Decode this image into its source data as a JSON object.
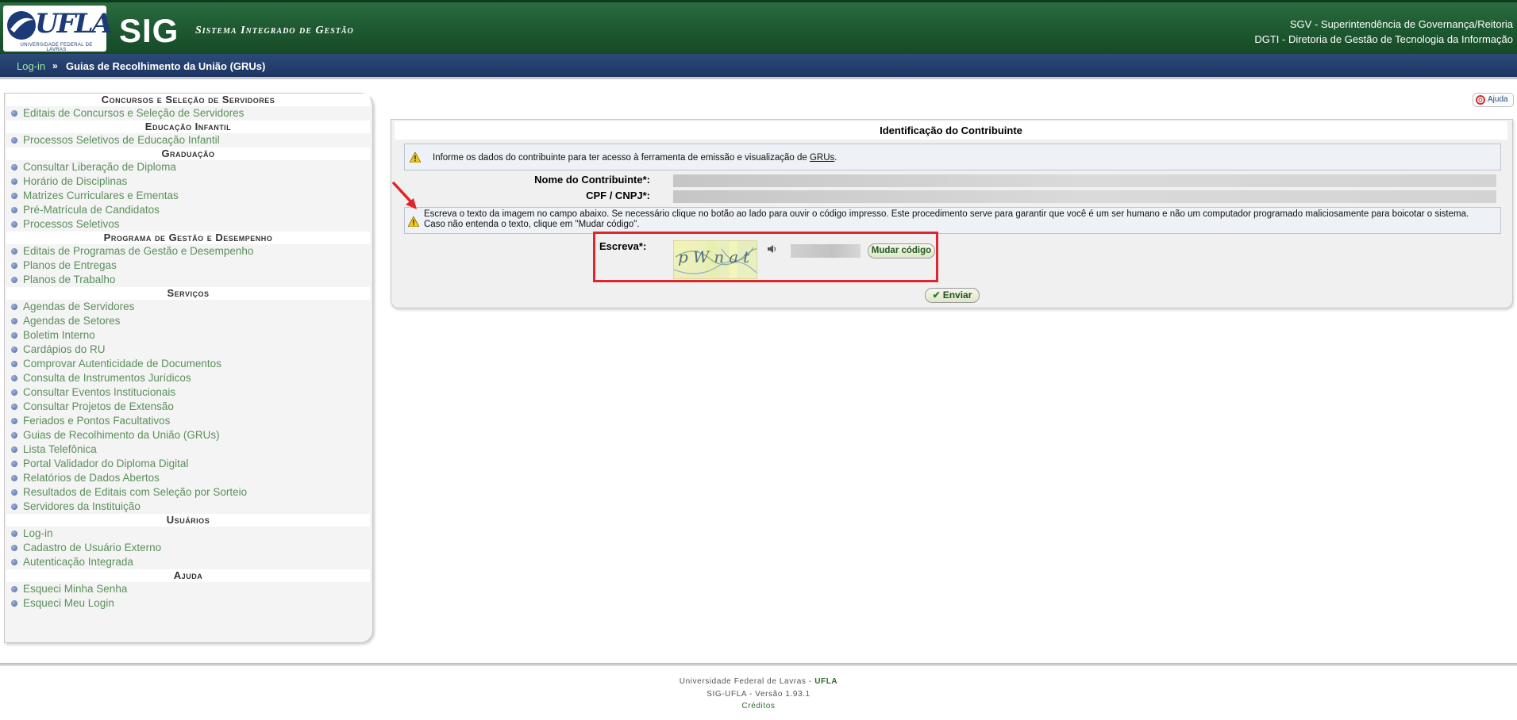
{
  "header": {
    "logo_text": "UFLA",
    "logo_subtitle": "UNIVERSIDADE FEDERAL DE LAVRAS",
    "app_title": "SIG",
    "app_subtitle": "Sistema Integrado de Gestão",
    "right_line_1": "SGV - Superintendência de Governança/Reitoria",
    "right_line_2": "DGTI - Diretoria de Gestão de Tecnologia da Informação"
  },
  "breadcrumb": {
    "link": "Log-in",
    "separator": "»",
    "current": "Guias de Recolhimento da União (GRUs)"
  },
  "sidebar": {
    "sections": [
      {
        "title": "Concursos e Seleção de Servidores",
        "items": [
          "Editais de Concursos e Seleção de Servidores"
        ]
      },
      {
        "title": "Educação Infantil",
        "items": [
          "Processos Seletivos de Educação Infantil"
        ]
      },
      {
        "title": "Graduação",
        "items": [
          "Consultar Liberação de Diploma",
          "Horário de Disciplinas",
          "Matrizes Curriculares e Ementas",
          "Pré-Matrícula de Candidatos",
          "Processos Seletivos"
        ]
      },
      {
        "title": "Programa de Gestão e Desempenho",
        "items": [
          "Editais de Programas de Gestão e Desempenho",
          "Planos de Entregas",
          "Planos de Trabalho"
        ]
      },
      {
        "title": "Serviços",
        "items": [
          "Agendas de Servidores",
          "Agendas de Setores",
          "Boletim Interno",
          "Cardápios do RU",
          "Comprovar Autenticidade de Documentos",
          "Consulta de Instrumentos Jurídicos",
          "Consultar Eventos Institucionais",
          "Consultar Projetos de Extensão",
          "Feriados e Pontos Facultativos",
          "Guias de Recolhimento da União (GRUs)",
          "Lista Telefônica",
          "Portal Validador do Diploma Digital",
          "Relatórios de Dados Abertos",
          "Resultados de Editais com Seleção por Sorteio",
          "Servidores da Instituição"
        ]
      },
      {
        "title": "Usuários",
        "items": [
          "Log-in",
          "Cadastro de Usuário Externo",
          "Autenticação Integrada"
        ]
      },
      {
        "title": "Ajuda",
        "items": [
          "Esqueci Minha Senha",
          "Esqueci Meu Login"
        ]
      }
    ]
  },
  "help_button": {
    "label": "Ajuda"
  },
  "form": {
    "title": "Identificação do Contribuinte",
    "info_text_before_link": "Informe os dados do contribuinte para ter acesso à ferramenta de emissão e visualização de ",
    "info_link": "GRUs",
    "info_text_after_link": ".",
    "name_label": "Nome do Contribuinte*:",
    "name_value": "",
    "cpf_label": "CPF / CNPJ*:",
    "cpf_value": "",
    "captcha_help_line_1": "Escreva o texto da imagem no campo abaixo. Se necessário clique no botão ao lado para ouvir o código impresso. Este procedimento serve para garantir que você é um ser humano e não um computador programado maliciosamente para boicotar o sistema.",
    "captcha_help_line_2": "Caso não entenda o texto, clique em \"Mudar código\".",
    "captcha_label": "Escreva*:",
    "captcha_image_text": "pWnat",
    "captcha_value": "",
    "change_code_button": "Mudar código",
    "submit_button": "Enviar"
  },
  "footer": {
    "line_1_prefix": "Universidade Federal de Lavras - ",
    "line_1_abbr": "UFLA",
    "line_2": "SIG-UFLA - Versão 1.93.1",
    "line_3": "Créditos"
  },
  "colors": {
    "header_green": "#1f5b32",
    "crumb_blue": "#1d3561",
    "link_green": "#5b8f5b",
    "highlight_red": "#e0252b"
  }
}
